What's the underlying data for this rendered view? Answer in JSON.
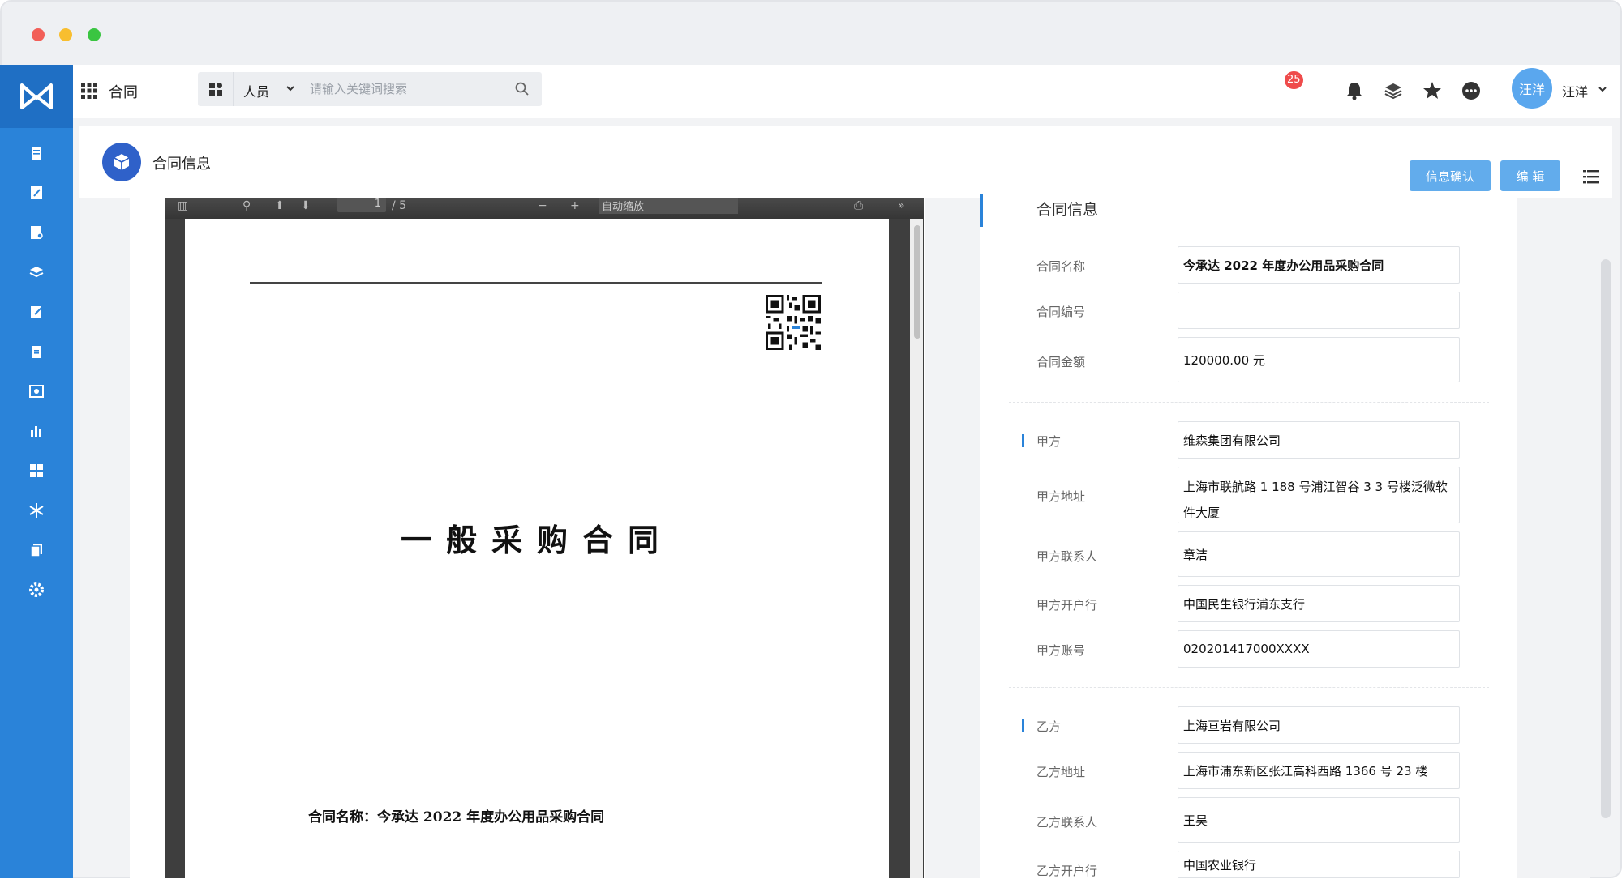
{
  "app": {
    "title": "合同",
    "search": {
      "category": "人员",
      "placeholder": "请输入关键词搜索"
    },
    "notifications_count": "25",
    "user": {
      "avatar_text": "汪洋",
      "name": "汪洋"
    }
  },
  "sidebar": {
    "items": [
      "documents-icon",
      "edit-doc-icon",
      "search-doc-icon",
      "layers-icon",
      "write-icon",
      "file-icon",
      "preview-icon",
      "chart-icon",
      "grid-icon",
      "snowflake-icon",
      "copy-icon",
      "settings-icon"
    ]
  },
  "subheader": {
    "title": "合同信息",
    "confirm_label": "信息确认",
    "edit_label": "编 辑"
  },
  "pdf": {
    "page_number": "1",
    "page_total": "/ 5",
    "zoom": "自动缩放",
    "doc_title": "一般采购合同",
    "contract_line": "合同名称：今承达 2022 年度办公用品采购合同"
  },
  "form": {
    "section_title": "合同信息",
    "fields": [
      {
        "label": "合同名称",
        "value": "今承达 2022 年度办公用品采购合同"
      },
      {
        "label": "合同编号",
        "value": ""
      },
      {
        "label": "合同金额",
        "value": "120000.00 元"
      },
      {
        "label": "甲方",
        "value": "维森集团有限公司"
      },
      {
        "label": "甲方地址",
        "value": "上海市联航路 1 188 号浦江智谷 3 3 号楼泛微软件大厦"
      },
      {
        "label": "甲方联系人",
        "value": "章洁"
      },
      {
        "label": "甲方开户行",
        "value": "中国民生银行浦东支行"
      },
      {
        "label": "甲方账号",
        "value": "020201417000XXXX"
      },
      {
        "label": "乙方",
        "value": "上海亘岩有限公司"
      },
      {
        "label": "乙方地址",
        "value": "上海市浦东新区张江高科西路 1366 号 23 楼"
      },
      {
        "label": "乙方联系人",
        "value": "王昊"
      },
      {
        "label": "乙方开户行",
        "value": "中国农业银行"
      }
    ]
  },
  "colors": {
    "sidebar": "#2a83d9",
    "button": "#62acec",
    "badge": "#ef4b4b",
    "module_icon": "#2f61c9"
  }
}
